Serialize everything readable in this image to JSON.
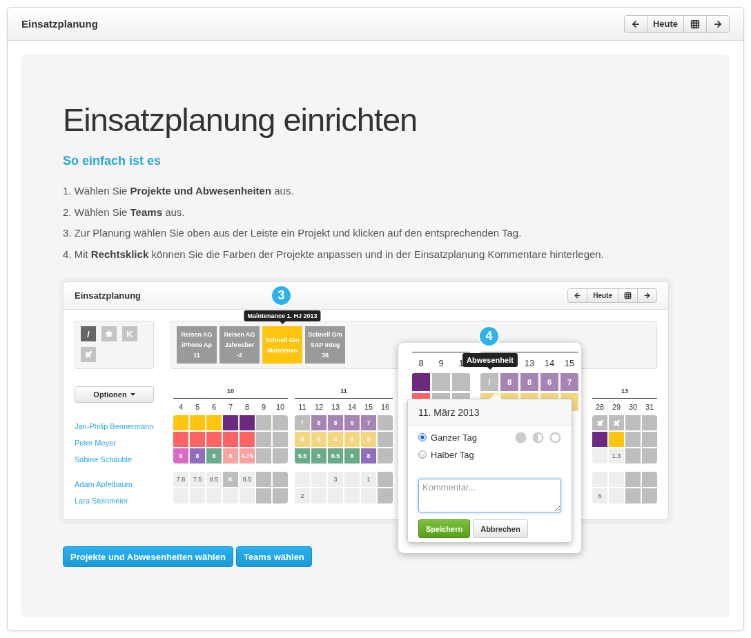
{
  "header": {
    "title": "Einsatzplanung",
    "nav": [
      {
        "kind": "prev"
      },
      {
        "kind": "today",
        "label": "Heute"
      },
      {
        "kind": "grid"
      },
      {
        "kind": "next"
      }
    ]
  },
  "intro": {
    "title": "Einsatzplanung einrichten",
    "subtitle": "So einfach ist es",
    "steps": [
      "1. Wählen Sie **Projekte und Abwesenheiten** aus.",
      "2. Wählen Sie **Teams** aus.",
      "3. Zur Planung wählen Sie oben aus der Leiste ein Projekt und klicken auf den entsprechenden Tag.",
      "4. Mit **Rechtsklick** können Sie die Farben der Projekte anpassen und in der Einsatzplanung Kommentare hinterlegen."
    ]
  },
  "preview": {
    "title": "Einsatzplanung",
    "nav": [
      {
        "kind": "prev"
      },
      {
        "kind": "today",
        "label": "Heute"
      },
      {
        "kind": "grid"
      },
      {
        "kind": "next"
      }
    ],
    "badge": "3",
    "project_tooltip": "Maintenance 1. HJ 2013",
    "absences": [
      {
        "kind": "text",
        "label": "/",
        "selected": true
      },
      {
        "kind": "star",
        "selected": false
      },
      {
        "kind": "text",
        "label": "K",
        "selected": false
      },
      {
        "kind": "plane",
        "selected": false
      }
    ],
    "projects": [
      {
        "company": "Reisen AG",
        "project": "iPhone Ap",
        "hours": "11",
        "selected": false
      },
      {
        "company": "Reisen AG",
        "project": "Jahresber",
        "hours": "-2",
        "selected": false
      },
      {
        "company": "Schnell Gm",
        "project": "Maintenan",
        "selected": true
      },
      {
        "company": "Schnell Gm",
        "project": "SAP Integ",
        "hours": "38",
        "selected": false
      }
    ],
    "options_button": "Optionen",
    "people_groups": [
      [
        "Jan-Philip Bennermann",
        "Peter Meyer",
        "Sabine Schäuble"
      ],
      [
        "Adam Apfelbaum",
        "Lara Steinmeier"
      ]
    ],
    "weeks": [
      {
        "label": "10",
        "days": [
          "4",
          "5",
          "6",
          "7",
          "8",
          "9",
          "10"
        ],
        "groups": [
          [
            [
              {
                "kind": "project",
                "color": "#ffc40d"
              },
              {
                "kind": "project",
                "color": "#ffc40d"
              },
              {
                "kind": "project",
                "color": "#ffc40d"
              },
              {
                "kind": "project",
                "color": "#6b2a80"
              },
              {
                "kind": "project",
                "color": "#6b2a80"
              },
              {
                "kind": "weekend"
              },
              {
                "kind": "weekend"
              }
            ],
            [
              {
                "kind": "project",
                "color": "#ff6464"
              },
              {
                "kind": "project",
                "color": "#ff6464"
              },
              {
                "kind": "project",
                "color": "#ff6464"
              },
              {
                "kind": "project",
                "color": "#ff6464"
              },
              {
                "kind": "project",
                "color": "#ff6464"
              },
              {
                "kind": "weekend"
              },
              {
                "kind": "weekend"
              }
            ],
            [
              {
                "kind": "project",
                "color": "#d96cc7",
                "text": "8"
              },
              {
                "kind": "project",
                "color": "#8e6fbf",
                "text": "8"
              },
              {
                "kind": "project",
                "color": "#6aab8a",
                "text": "8"
              },
              {
                "kind": "project",
                "color": "#f7a1a1",
                "text": "8"
              },
              {
                "kind": "project",
                "color": "#f7a1a1",
                "text": "4.75"
              },
              {
                "kind": "weekend"
              },
              {
                "kind": "weekend"
              }
            ]
          ],
          [
            [
              {
                "kind": "free",
                "text": "7.8"
              },
              {
                "kind": "free",
                "text": "7.5"
              },
              {
                "kind": "free",
                "text": "8.5"
              },
              {
                "kind": "absence",
                "text": "K"
              },
              {
                "kind": "free",
                "text": "8.5"
              },
              {
                "kind": "weekend"
              },
              {
                "kind": "weekend"
              }
            ],
            [
              {
                "kind": "free"
              },
              {
                "kind": "free"
              },
              {
                "kind": "free"
              },
              {
                "kind": "free"
              },
              {
                "kind": "free"
              },
              {
                "kind": "weekend"
              },
              {
                "kind": "weekend"
              }
            ]
          ]
        ]
      },
      {
        "label": "11",
        "days": [
          "11",
          "12",
          "13",
          "14",
          "15",
          "16"
        ],
        "groups": [
          [
            [
              {
                "kind": "absence",
                "text": "/"
              },
              {
                "kind": "project",
                "color": "#a784b5",
                "text": "8"
              },
              {
                "kind": "project",
                "color": "#a784b5",
                "text": "8"
              },
              {
                "kind": "project",
                "color": "#a784b5",
                "text": "6"
              },
              {
                "kind": "project",
                "color": "#a784b5",
                "text": "7"
              },
              {
                "kind": "weekend"
              }
            ],
            [
              {
                "kind": "project",
                "color": "#f5d67f",
                "text": "8"
              },
              {
                "kind": "project",
                "color": "#f5d67f",
                "text": "8"
              },
              {
                "kind": "project",
                "color": "#f5d67f",
                "text": "4"
              },
              {
                "kind": "project",
                "color": "#f5d67f",
                "text": "6"
              },
              {
                "kind": "project",
                "color": "#f5d67f",
                "text": "8"
              },
              {
                "kind": "weekend"
              }
            ],
            [
              {
                "kind": "project",
                "color": "#6aab8a",
                "text": "5.5"
              },
              {
                "kind": "project",
                "color": "#6aab8a",
                "text": "5"
              },
              {
                "kind": "project",
                "color": "#6aab8a",
                "text": "6.5"
              },
              {
                "kind": "project",
                "color": "#6aab8a",
                "text": "8"
              },
              {
                "kind": "project",
                "color": "#8e6fbf",
                "text": "8"
              },
              {
                "kind": "weekend"
              }
            ]
          ],
          [
            [
              {
                "kind": "free"
              },
              {
                "kind": "free"
              },
              {
                "kind": "free",
                "text": "3"
              },
              {
                "kind": "free"
              },
              {
                "kind": "free",
                "text": "1"
              },
              {
                "kind": "weekend"
              }
            ],
            [
              {
                "kind": "free",
                "text": "2"
              },
              {
                "kind": "free"
              },
              {
                "kind": "free"
              },
              {
                "kind": "free"
              },
              {
                "kind": "free"
              },
              {
                "kind": "weekend"
              }
            ]
          ]
        ]
      },
      {
        "label": "13",
        "days": [
          "28",
          "29",
          "30",
          "31"
        ],
        "groups": [
          [
            [
              {
                "kind": "travel"
              },
              {
                "kind": "travel"
              },
              {
                "kind": "weekend"
              },
              {
                "kind": "weekend"
              }
            ],
            [
              {
                "kind": "project",
                "color": "#6b2a80"
              },
              {
                "kind": "project",
                "color": "#ffc40d"
              },
              {
                "kind": "weekend"
              },
              {
                "kind": "weekend"
              }
            ],
            [
              {
                "kind": "free"
              },
              {
                "kind": "free",
                "text": "1.3"
              },
              {
                "kind": "weekend"
              },
              {
                "kind": "weekend"
              }
            ]
          ],
          [
            [
              {
                "kind": "free"
              },
              {
                "kind": "free"
              },
              {
                "kind": "weekend"
              },
              {
                "kind": "weekend"
              }
            ],
            [
              {
                "kind": "free",
                "text": "6"
              },
              {
                "kind": "free"
              },
              {
                "kind": "weekend"
              },
              {
                "kind": "weekend"
              }
            ]
          ]
        ]
      }
    ]
  },
  "zoom": {
    "badge": "4",
    "tooltip": "Abwesenheit",
    "left_days": [
      "8",
      "9",
      "1"
    ],
    "right_days": [
      "13",
      "14",
      "15"
    ],
    "left_rows": [
      [
        {
          "kind": "project",
          "color": "#6b2a80"
        },
        {
          "kind": "weekend"
        },
        {
          "kind": "weekend"
        }
      ],
      [
        {
          "kind": "project",
          "color": "#ff6464"
        },
        {
          "kind": "weekend"
        },
        {
          "kind": "weekend"
        }
      ]
    ],
    "right_rows": [
      [
        {
          "kind": "absence",
          "text": "/"
        },
        {
          "kind": "project",
          "color": "#a784b5",
          "text": "8"
        },
        {
          "kind": "project",
          "color": "#a784b5",
          "text": "8"
        },
        {
          "kind": "project",
          "color": "#a784b5",
          "text": "6"
        },
        {
          "kind": "project",
          "color": "#a784b5",
          "text": "7"
        }
      ],
      [
        {
          "kind": "project",
          "color": "#f5d67f"
        },
        {
          "kind": "project",
          "color": "#f5d67f"
        },
        {
          "kind": "project",
          "color": "#f5d67f"
        },
        {
          "kind": "project",
          "color": "#f5d67f"
        },
        {
          "kind": "project",
          "color": "#f5d67f"
        }
      ]
    ],
    "date": {
      "title": "11. März 2013",
      "options": [
        {
          "label": "Ganzer Tag",
          "selected": true
        },
        {
          "label": "Halber Tag",
          "selected": false
        }
      ],
      "comment": {
        "placeholder": "Kommentar..."
      },
      "buttons": [
        {
          "kind": "primary",
          "label": "Speichern"
        },
        {
          "kind": "default",
          "label": "Abbrechen"
        }
      ]
    }
  },
  "actions": [
    "Projekte und Abwesenheiten wählen",
    "Teams wählen"
  ]
}
